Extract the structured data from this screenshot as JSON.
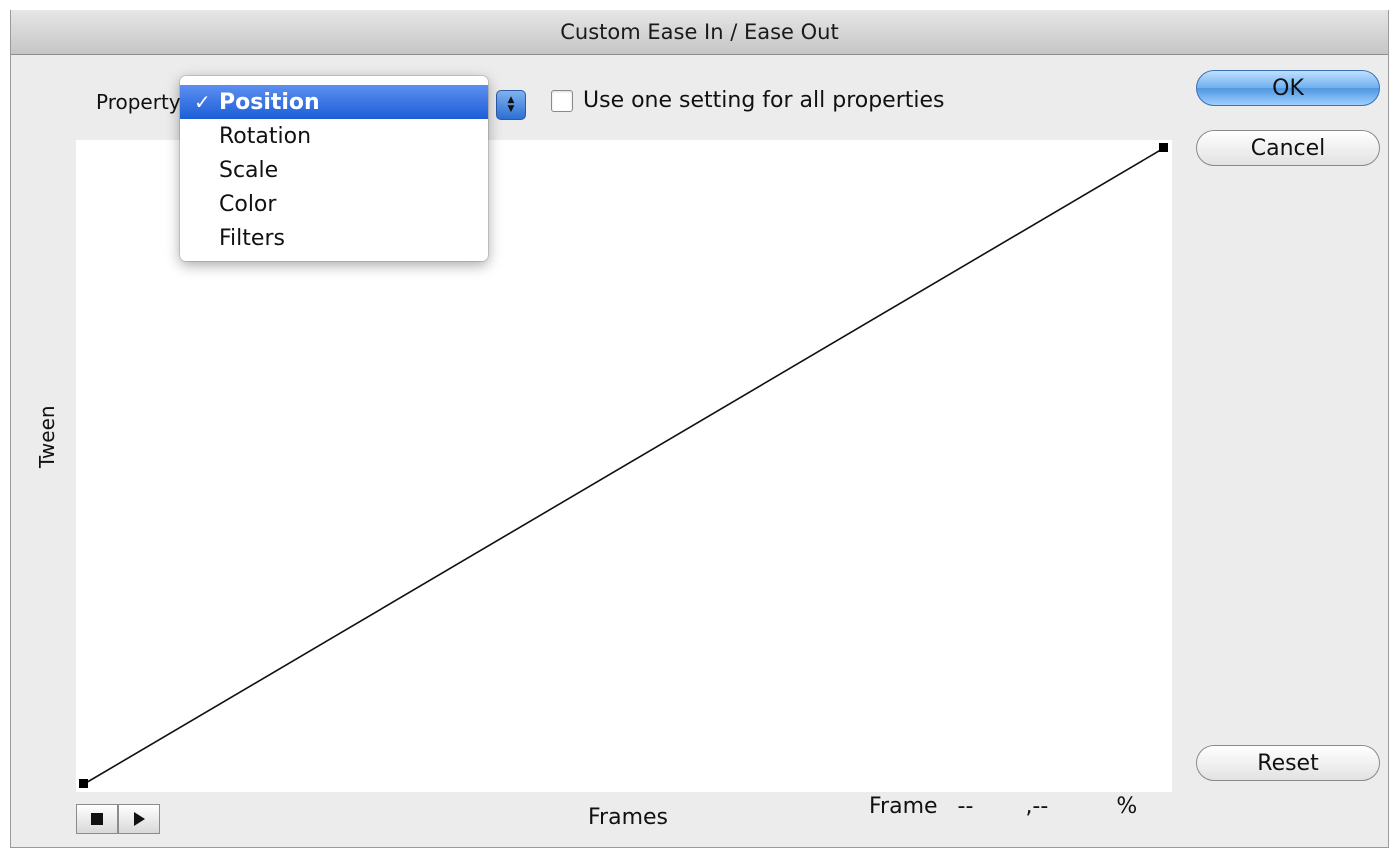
{
  "dialog": {
    "title": "Custom Ease In / Ease Out"
  },
  "property": {
    "label": "Property:",
    "options": [
      {
        "label": "Position",
        "selected": true
      },
      {
        "label": "Rotation",
        "selected": false
      },
      {
        "label": "Scale",
        "selected": false
      },
      {
        "label": "Color",
        "selected": false
      },
      {
        "label": "Filters",
        "selected": false
      }
    ],
    "check_glyph": "✓"
  },
  "use_one_setting": {
    "label": "Use one setting for all properties",
    "checked": false
  },
  "graph": {
    "y_label": "Tween",
    "x_label": "Frames",
    "curve": "linear"
  },
  "readout": {
    "frame_label": "Frame",
    "frame_value": "--",
    "tween_value": ",--",
    "percent": "%"
  },
  "buttons": {
    "ok": "OK",
    "cancel": "Cancel",
    "reset": "Reset"
  },
  "playback": {
    "stop_icon": "stop-icon",
    "play_icon": "play-icon"
  },
  "colors": {
    "accent": "#1c5ed8",
    "background": "#ececec"
  }
}
